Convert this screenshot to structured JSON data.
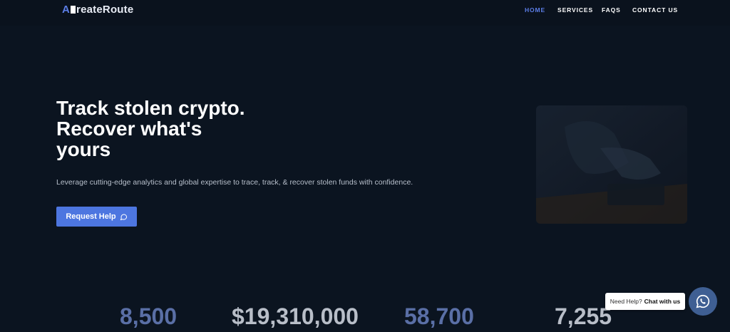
{
  "brand": {
    "part1": "A",
    "part2": "reate",
    "part3": "Route",
    "accent_color": "#5b7de6"
  },
  "nav": {
    "items": [
      {
        "label": "HOME",
        "active": true
      },
      {
        "label": "SERVICES",
        "active": false
      },
      {
        "label": "FAQS",
        "active": false
      },
      {
        "label": "CONTACT US",
        "active": false
      }
    ]
  },
  "hero": {
    "title_line1": "Track stolen crypto.",
    "title_line2": "Recover what's",
    "title_line3": "yours",
    "subtitle": "Leverage cutting-edge analytics and global expertise to trace, track, & recover stolen funds with confidence.",
    "button_label": "Request Help",
    "button_icon": "chat-bubble-icon",
    "button_color": "#4d76e0"
  },
  "stats": [
    {
      "value": "8,500"
    },
    {
      "value": "$19,310,000"
    },
    {
      "value": "58,700"
    },
    {
      "value": "7,255"
    }
  ],
  "chat_widget": {
    "prefix": "Need Help?",
    "action": "Chat with us",
    "icon": "whatsapp-icon"
  }
}
